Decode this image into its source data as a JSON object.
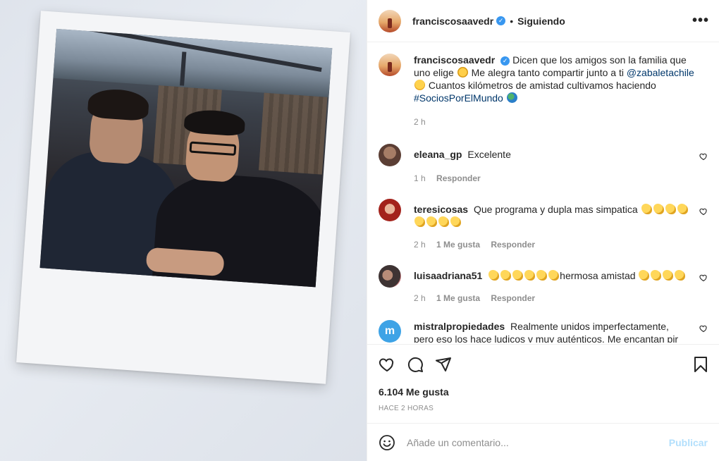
{
  "header": {
    "username": "franciscosaavedr",
    "verified_mark": "✓",
    "separator": "•",
    "follow_status": "Siguiendo",
    "more_label": "•••"
  },
  "caption": {
    "username": "franciscosaavedr",
    "text_1": "Dicen que los amigos son la familia que uno elige",
    "text_2": "Me alegra tanto compartir junto a ti",
    "mention": "@zabaletachile",
    "text_3": "Cuantos kilómetros de amistad cultivamos haciendo",
    "hashtag": "#SociosPorElMundo",
    "time": "2 h"
  },
  "comments": [
    {
      "username": "eleana_gp",
      "text": "Excelente",
      "time": "1 h",
      "likes": "",
      "reply": "Responder"
    },
    {
      "username": "teresicosas",
      "text": "Que programa y dupla mas simpatica",
      "time": "2 h",
      "likes": "1 Me gusta",
      "reply": "Responder"
    },
    {
      "username": "luisaadriana51",
      "text": "hermosa amistad",
      "time": "2 h",
      "likes": "1 Me gusta",
      "reply": "Responder"
    },
    {
      "username": "mistralpropiedades",
      "text": "Realmente unidos imperfectamente, pero eso los hace ludicos y muy auténticos. Me encantan pir su",
      "avatar_letter": "m"
    }
  ],
  "likes": "6.104 Me gusta",
  "posted": "HACE 2 HORAS",
  "add_comment": {
    "placeholder": "Añade un comentario...",
    "publish": "Publicar"
  },
  "colors": {
    "verified": "#3897f0",
    "link": "#00376b",
    "muted": "#8e8e8e",
    "publish_disabled": "#b2dffc",
    "mistral_avatar": "#3ea3e6"
  },
  "icons": [
    "heart-icon",
    "comment-icon",
    "share-icon",
    "bookmark-icon",
    "emoji-icon",
    "more-icon",
    "heart-small-icon"
  ]
}
